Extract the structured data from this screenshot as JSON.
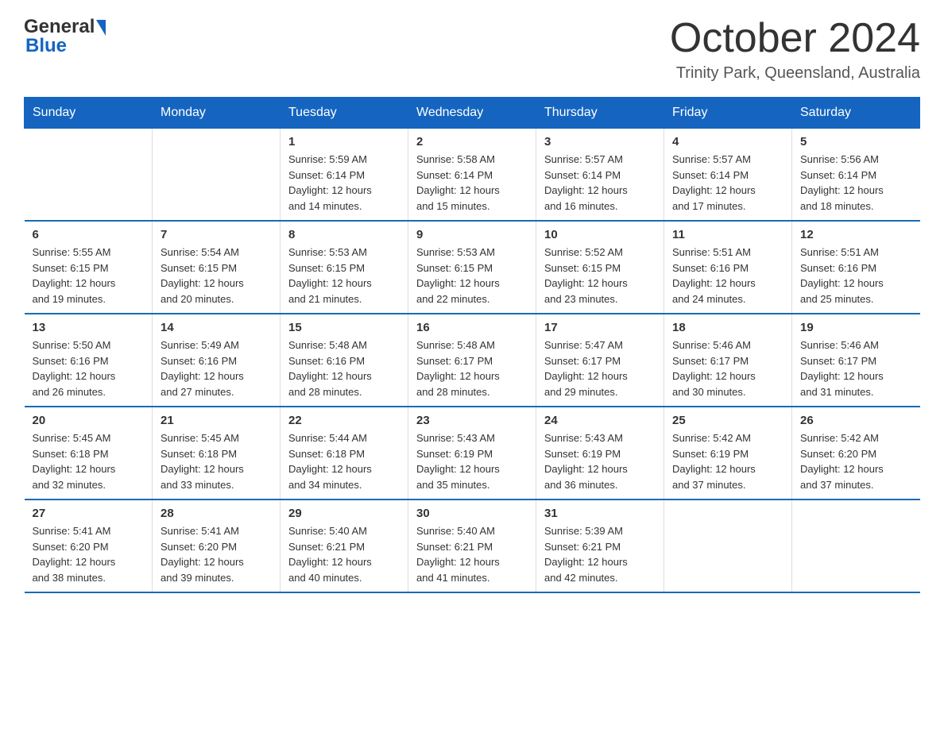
{
  "header": {
    "logo_general": "General",
    "logo_blue": "Blue",
    "month_title": "October 2024",
    "location": "Trinity Park, Queensland, Australia"
  },
  "weekdays": [
    "Sunday",
    "Monday",
    "Tuesday",
    "Wednesday",
    "Thursday",
    "Friday",
    "Saturday"
  ],
  "weeks": [
    [
      {
        "day": "",
        "info": ""
      },
      {
        "day": "",
        "info": ""
      },
      {
        "day": "1",
        "info": "Sunrise: 5:59 AM\nSunset: 6:14 PM\nDaylight: 12 hours\nand 14 minutes."
      },
      {
        "day": "2",
        "info": "Sunrise: 5:58 AM\nSunset: 6:14 PM\nDaylight: 12 hours\nand 15 minutes."
      },
      {
        "day": "3",
        "info": "Sunrise: 5:57 AM\nSunset: 6:14 PM\nDaylight: 12 hours\nand 16 minutes."
      },
      {
        "day": "4",
        "info": "Sunrise: 5:57 AM\nSunset: 6:14 PM\nDaylight: 12 hours\nand 17 minutes."
      },
      {
        "day": "5",
        "info": "Sunrise: 5:56 AM\nSunset: 6:14 PM\nDaylight: 12 hours\nand 18 minutes."
      }
    ],
    [
      {
        "day": "6",
        "info": "Sunrise: 5:55 AM\nSunset: 6:15 PM\nDaylight: 12 hours\nand 19 minutes."
      },
      {
        "day": "7",
        "info": "Sunrise: 5:54 AM\nSunset: 6:15 PM\nDaylight: 12 hours\nand 20 minutes."
      },
      {
        "day": "8",
        "info": "Sunrise: 5:53 AM\nSunset: 6:15 PM\nDaylight: 12 hours\nand 21 minutes."
      },
      {
        "day": "9",
        "info": "Sunrise: 5:53 AM\nSunset: 6:15 PM\nDaylight: 12 hours\nand 22 minutes."
      },
      {
        "day": "10",
        "info": "Sunrise: 5:52 AM\nSunset: 6:15 PM\nDaylight: 12 hours\nand 23 minutes."
      },
      {
        "day": "11",
        "info": "Sunrise: 5:51 AM\nSunset: 6:16 PM\nDaylight: 12 hours\nand 24 minutes."
      },
      {
        "day": "12",
        "info": "Sunrise: 5:51 AM\nSunset: 6:16 PM\nDaylight: 12 hours\nand 25 minutes."
      }
    ],
    [
      {
        "day": "13",
        "info": "Sunrise: 5:50 AM\nSunset: 6:16 PM\nDaylight: 12 hours\nand 26 minutes."
      },
      {
        "day": "14",
        "info": "Sunrise: 5:49 AM\nSunset: 6:16 PM\nDaylight: 12 hours\nand 27 minutes."
      },
      {
        "day": "15",
        "info": "Sunrise: 5:48 AM\nSunset: 6:16 PM\nDaylight: 12 hours\nand 28 minutes."
      },
      {
        "day": "16",
        "info": "Sunrise: 5:48 AM\nSunset: 6:17 PM\nDaylight: 12 hours\nand 28 minutes."
      },
      {
        "day": "17",
        "info": "Sunrise: 5:47 AM\nSunset: 6:17 PM\nDaylight: 12 hours\nand 29 minutes."
      },
      {
        "day": "18",
        "info": "Sunrise: 5:46 AM\nSunset: 6:17 PM\nDaylight: 12 hours\nand 30 minutes."
      },
      {
        "day": "19",
        "info": "Sunrise: 5:46 AM\nSunset: 6:17 PM\nDaylight: 12 hours\nand 31 minutes."
      }
    ],
    [
      {
        "day": "20",
        "info": "Sunrise: 5:45 AM\nSunset: 6:18 PM\nDaylight: 12 hours\nand 32 minutes."
      },
      {
        "day": "21",
        "info": "Sunrise: 5:45 AM\nSunset: 6:18 PM\nDaylight: 12 hours\nand 33 minutes."
      },
      {
        "day": "22",
        "info": "Sunrise: 5:44 AM\nSunset: 6:18 PM\nDaylight: 12 hours\nand 34 minutes."
      },
      {
        "day": "23",
        "info": "Sunrise: 5:43 AM\nSunset: 6:19 PM\nDaylight: 12 hours\nand 35 minutes."
      },
      {
        "day": "24",
        "info": "Sunrise: 5:43 AM\nSunset: 6:19 PM\nDaylight: 12 hours\nand 36 minutes."
      },
      {
        "day": "25",
        "info": "Sunrise: 5:42 AM\nSunset: 6:19 PM\nDaylight: 12 hours\nand 37 minutes."
      },
      {
        "day": "26",
        "info": "Sunrise: 5:42 AM\nSunset: 6:20 PM\nDaylight: 12 hours\nand 37 minutes."
      }
    ],
    [
      {
        "day": "27",
        "info": "Sunrise: 5:41 AM\nSunset: 6:20 PM\nDaylight: 12 hours\nand 38 minutes."
      },
      {
        "day": "28",
        "info": "Sunrise: 5:41 AM\nSunset: 6:20 PM\nDaylight: 12 hours\nand 39 minutes."
      },
      {
        "day": "29",
        "info": "Sunrise: 5:40 AM\nSunset: 6:21 PM\nDaylight: 12 hours\nand 40 minutes."
      },
      {
        "day": "30",
        "info": "Sunrise: 5:40 AM\nSunset: 6:21 PM\nDaylight: 12 hours\nand 41 minutes."
      },
      {
        "day": "31",
        "info": "Sunrise: 5:39 AM\nSunset: 6:21 PM\nDaylight: 12 hours\nand 42 minutes."
      },
      {
        "day": "",
        "info": ""
      },
      {
        "day": "",
        "info": ""
      }
    ]
  ]
}
